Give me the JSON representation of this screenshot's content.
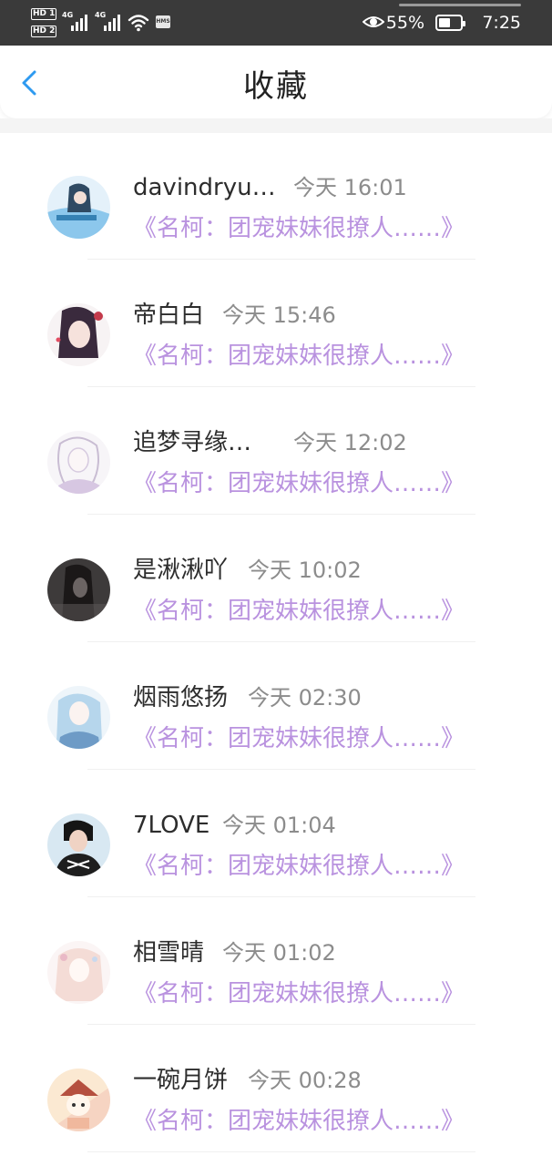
{
  "status_bar": {
    "sim1_badge": "HD",
    "sim1_index": "1",
    "sim2_badge": "HD",
    "sim2_index": "2",
    "network1": "4G",
    "network2": "4G",
    "hms_label": "HMS",
    "battery_percent": "55%",
    "time": "7:25"
  },
  "header": {
    "title": "收藏",
    "back_icon": "chevron-left-icon",
    "accent_color": "#2e9af0"
  },
  "favorites": [
    {
      "name": "davindryu…",
      "time": "今天 16:01",
      "book": "《名柯：团宠妹妹很撩人……》",
      "avatar": "avatar-blue-anime"
    },
    {
      "name": "帝白白",
      "time": "今天 15:46",
      "book": "《名柯：团宠妹妹很撩人……》",
      "avatar": "avatar-dark-hair-girl"
    },
    {
      "name": "追梦寻缘…",
      "time": "今天 12:02",
      "book": "《名柯：团宠妹妹很撩人……》",
      "avatar": "avatar-sketch-girl"
    },
    {
      "name": "是湫湫吖",
      "time": "今天 10:02",
      "book": "《名柯：团宠妹妹很撩人……》",
      "avatar": "avatar-dark-photo"
    },
    {
      "name": "烟雨悠扬",
      "time": "今天 02:30",
      "book": "《名柯：团宠妹妹很撩人……》",
      "avatar": "avatar-light-blue-anime"
    },
    {
      "name": "7LOVE",
      "time": "今天 01:04",
      "book": "《名柯：团宠妹妹很撩人……》",
      "avatar": "avatar-person-photo"
    },
    {
      "name": "相雪晴",
      "time": "今天 01:02",
      "book": "《名柯：团宠妹妹很撩人……》",
      "avatar": "avatar-pastel-anime"
    },
    {
      "name": "一碗月饼",
      "time": "今天 00:28",
      "book": "《名柯：团宠妹妹很撩人……》",
      "avatar": "avatar-cartoon-kid"
    }
  ],
  "colors": {
    "link": "#b992df",
    "name": "#2d2d2d",
    "time": "#8c8c8c",
    "status_bar": "#3a3a3a"
  }
}
